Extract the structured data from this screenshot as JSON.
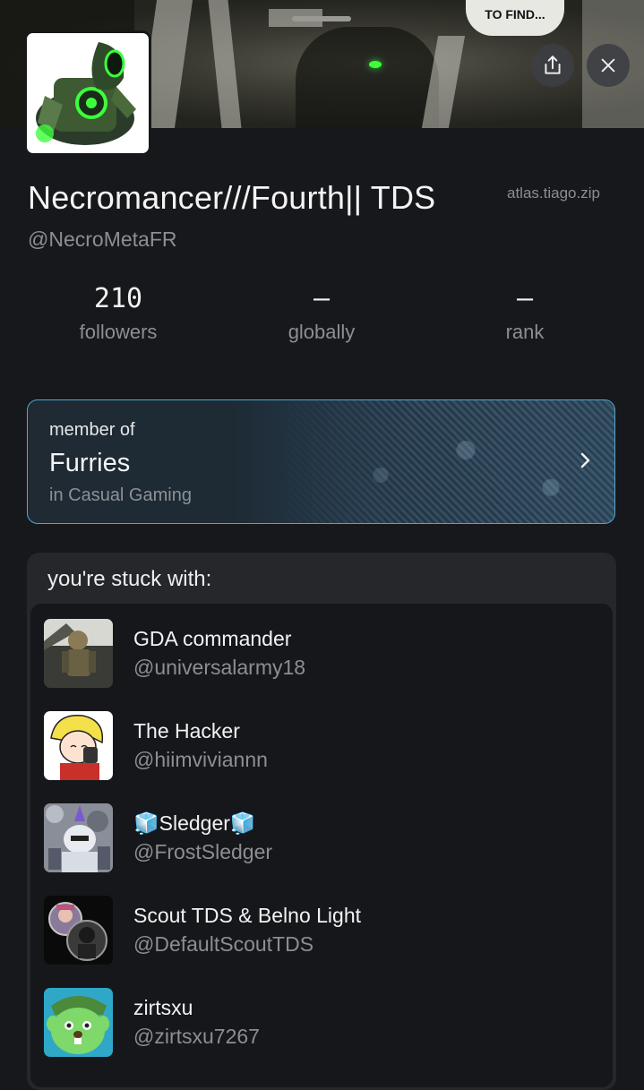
{
  "banner": {
    "caption": "TO FIND..."
  },
  "header": {
    "share_icon": "share-icon",
    "close_icon": "close-icon"
  },
  "profile": {
    "display_name": "Necromancer///Fourth|| TDS",
    "handle": "@NecroMetaFR",
    "watermark": "atlas.tiago.zip"
  },
  "stats": [
    {
      "value": "210",
      "label": "followers"
    },
    {
      "value": "—",
      "label": "globally"
    },
    {
      "value": "—",
      "label": "rank"
    }
  ],
  "membership": {
    "prefix": "member of",
    "group": "Furries",
    "category": "in Casual Gaming",
    "accent": "#4fa7cf"
  },
  "stuck": {
    "title": "you're stuck with:",
    "people": [
      {
        "name": "GDA commander",
        "handle": "@universalarmy18"
      },
      {
        "name": "🧊Sledger🧊",
        "handle": "@FrostSledger"
      },
      {
        "name": "The Hacker",
        "handle": "@hiimviviannn"
      },
      {
        "name": "Scout TDS & Belno Light",
        "handle": "@DefaultScoutTDS"
      },
      {
        "name": "zirtsxu",
        "handle": "@zirtsxu7267"
      }
    ]
  }
}
